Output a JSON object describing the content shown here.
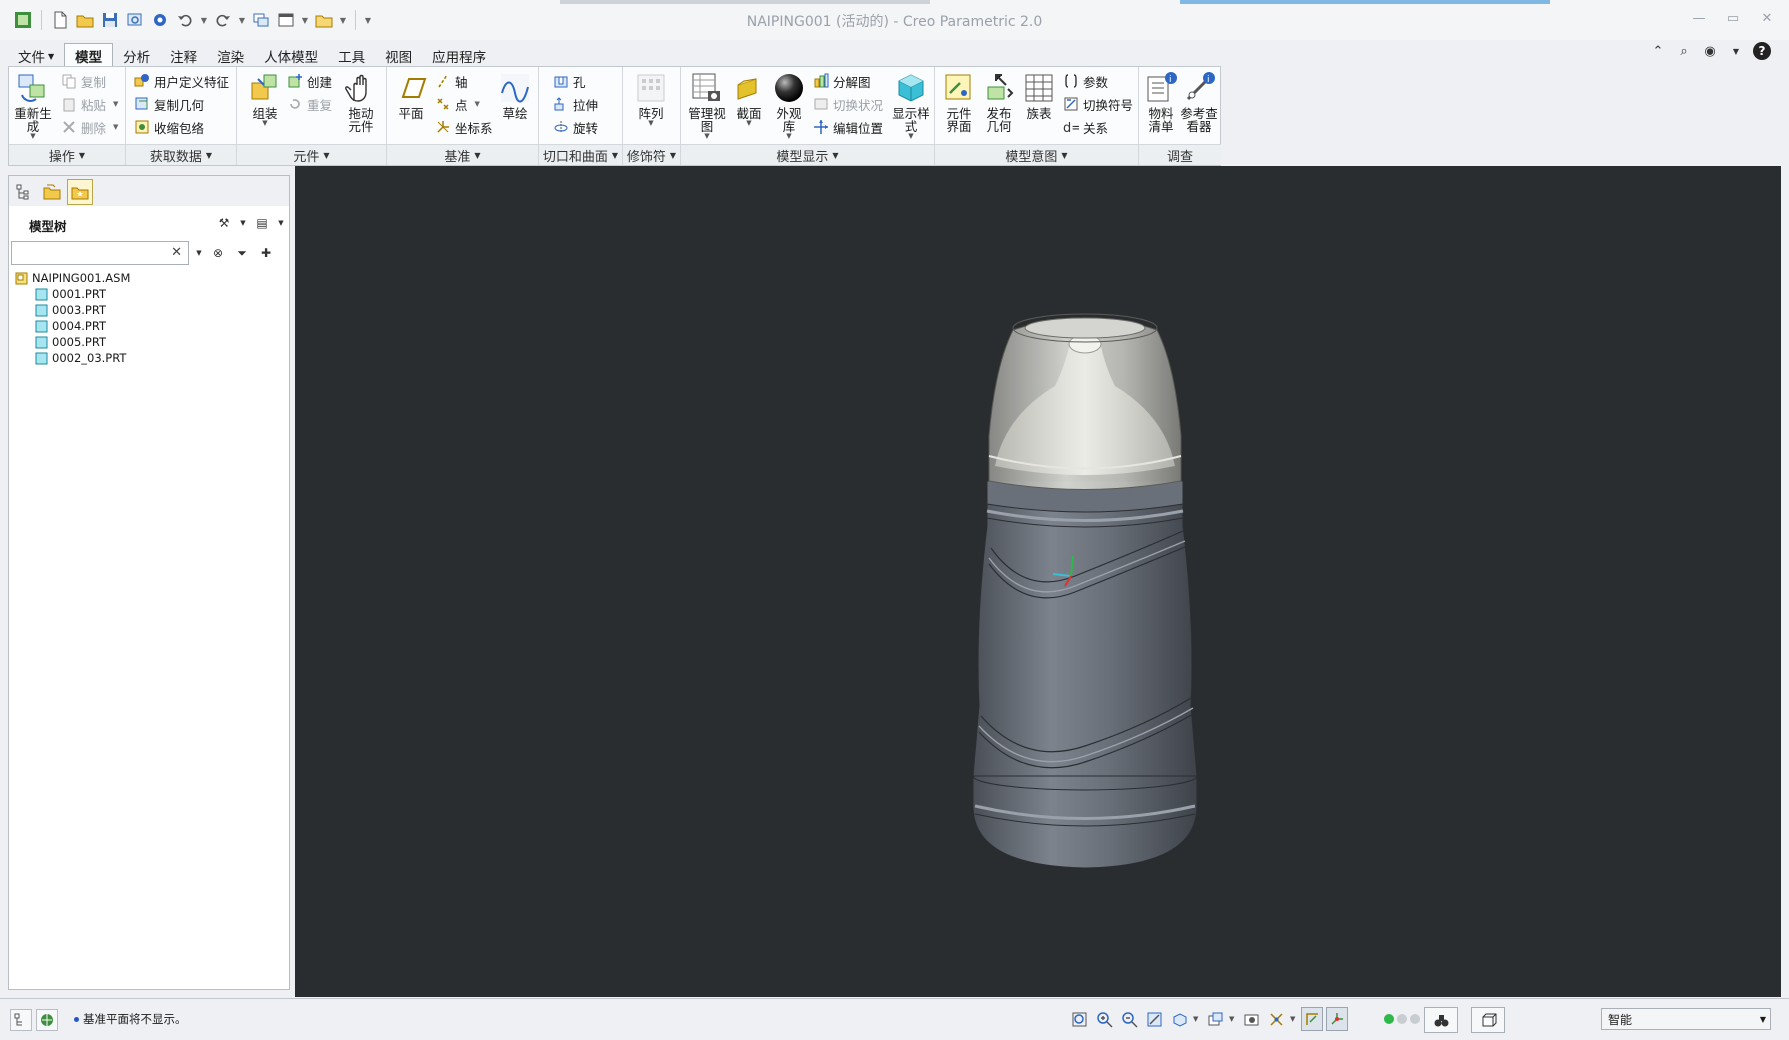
{
  "window": {
    "title": "NAIPING001 (活动的) - Creo Parametric 2.0"
  },
  "quick_access": {
    "icons": [
      "app-icon",
      "new-icon",
      "open-icon",
      "save-icon",
      "regenerate-icon",
      "settings-icon",
      "undo-icon",
      "redo-icon",
      "windows-icon",
      "close-window-icon",
      "folder-icon",
      "customize-icon"
    ]
  },
  "tabs": [
    {
      "label": "文件",
      "has_menu": true
    },
    {
      "label": "模型",
      "active": true
    },
    {
      "label": "分析"
    },
    {
      "label": "注释"
    },
    {
      "label": "渲染"
    },
    {
      "label": "人体模型"
    },
    {
      "label": "工具"
    },
    {
      "label": "视图"
    },
    {
      "label": "应用程序"
    }
  ],
  "ribbon": {
    "operations": {
      "label": "操作",
      "regenerate": "重新生成",
      "copy": "复制",
      "paste": "粘贴",
      "delete": "删除"
    },
    "get_data": {
      "label": "获取数据",
      "udf": "用户定义特征",
      "copy_geom": "复制几何",
      "shrinkwrap": "收缩包络"
    },
    "component": {
      "label": "元件",
      "assemble": "组装",
      "create": "创建",
      "repeat": "重复",
      "drag": "拖动元件"
    },
    "datum": {
      "label": "基准",
      "plane": "平面",
      "axis": "轴",
      "point": "点",
      "csys": "坐标系",
      "sketch": "草绘"
    },
    "cut_surface": {
      "label": "切口和曲面",
      "hole": "孔",
      "extrude": "拉伸",
      "revolve": "旋转"
    },
    "modifiers": {
      "label": "修饰符",
      "pattern": "阵列"
    },
    "model_display": {
      "label": "模型显示",
      "manage_views": "管理视图",
      "section": "截面",
      "appearance": "外观库",
      "explode": "分解图",
      "toggle_status": "切换状况",
      "edit_position": "编辑位置",
      "display_style": "显示样式"
    },
    "model_intent": {
      "label": "模型意图",
      "component_interface": "元件界面",
      "publish_geom": "发布几何",
      "family_table": "族表",
      "parameters": "参数",
      "toggle_symbol": "切换符号",
      "relations": "关系"
    },
    "investigate": {
      "label": "调查",
      "bom": "物料清单",
      "reference_viewer": "参考查看器"
    }
  },
  "left_panel": {
    "title": "模型树",
    "search_placeholder": "",
    "tree": {
      "root": "NAIPING001.ASM",
      "children": [
        "0001.PRT",
        "0003.PRT",
        "0004.PRT",
        "0005.PRT",
        "0002_03.PRT"
      ]
    }
  },
  "status_bar": {
    "message": "基准平面将不显示。",
    "filter_value": "智能"
  },
  "colors": {
    "viewport_bg": "#2a2d2f",
    "bottle_body": "#5e646d",
    "bottle_cap": "#b7b8b3",
    "accent_active_tab": "#fdf6d0"
  }
}
